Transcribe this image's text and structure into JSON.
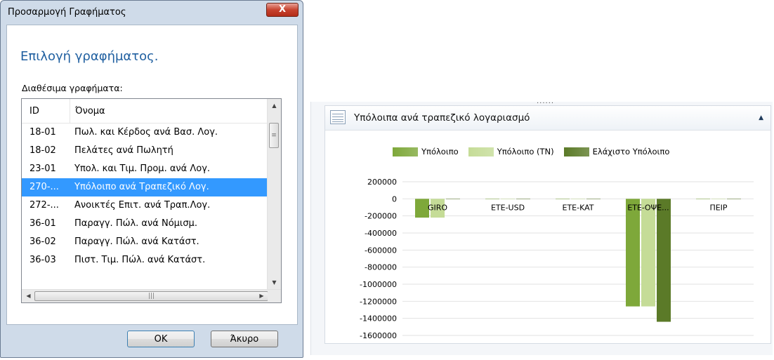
{
  "dialog": {
    "title": "Προσαρμογή Γραφήματος",
    "close_label": "X",
    "heading": "Επιλογή γραφήματος.",
    "list_label": "Διαθέσιμα γραφήματα:",
    "columns": {
      "id": "ID",
      "name": "Όνομα"
    },
    "rows": [
      {
        "id": "18-01",
        "name": "Πωλ. και Κέρδος ανά Βασ. Λογ."
      },
      {
        "id": "18-02",
        "name": "Πελάτες ανά Πωλητή"
      },
      {
        "id": "23-01",
        "name": "Υπολ. και Τιμ. Προμ. ανά Λογ."
      },
      {
        "id": "270-...",
        "name": "Υπόλοιπο ανά Τραπεζικό Λογ."
      },
      {
        "id": "272-...",
        "name": "Ανοικτές Επιτ. ανά Τραπ.Λογ."
      },
      {
        "id": "36-01",
        "name": "Παραγγ. Πώλ. ανά Νόμισμ."
      },
      {
        "id": "36-02",
        "name": "Παραγγ. Πώλ. ανά Κατάστ."
      },
      {
        "id": "36-03",
        "name": "Πιστ. Τιμ. Πώλ. ανά Κατάστ."
      }
    ],
    "selected_index": 3,
    "ok_label": "OK",
    "cancel_label": "Άκυρο"
  },
  "panel": {
    "grip": "......",
    "title": "Υπόλοιπα ανά τραπεζικό λογαριασμό"
  },
  "chart_data": {
    "type": "bar",
    "categories": [
      "GIRO",
      "ETE-USD",
      "ETE-KAT",
      "ETE-ΟΨΕ...",
      "ΠΕΙΡ"
    ],
    "series": [
      {
        "name": "Υπόλοιπο",
        "color": "#7ea83a",
        "values": [
          -220000,
          0,
          0,
          -1260000,
          0
        ]
      },
      {
        "name": "Υπόλοιπο (ΤΝ)",
        "color": "#c5dc97",
        "values": [
          -220000,
          0,
          0,
          -1260000,
          0
        ]
      },
      {
        "name": "Ελάχιστο Υπόλοιπο",
        "color": "#5b7a28",
        "values": [
          0,
          0,
          0,
          -1440000,
          0
        ]
      }
    ],
    "yticks": [
      "200000",
      "0",
      "-200000",
      "-400000",
      "-600000",
      "-800000",
      "-1000000",
      "-1200000",
      "-1400000",
      "-1600000"
    ],
    "ylim": [
      -1600000,
      200000
    ],
    "grid": true,
    "legend_position": "top"
  }
}
